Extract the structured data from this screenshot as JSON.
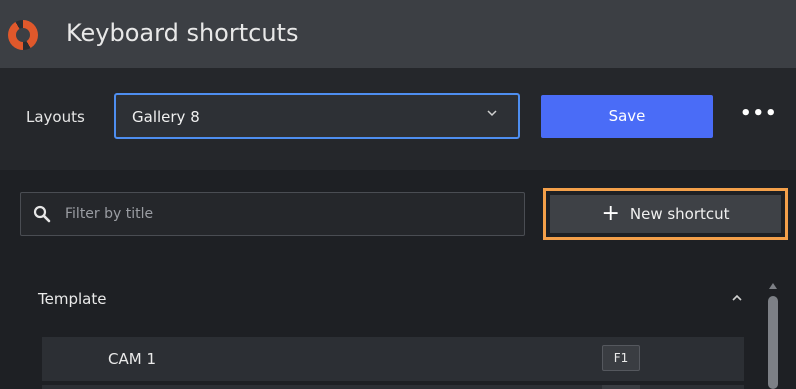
{
  "window": {
    "title": "Keyboard shortcuts"
  },
  "toolbar": {
    "layouts_label": "Layouts",
    "layout_selected": "Gallery 8",
    "save_label": "Save",
    "more_label": "•••"
  },
  "filter": {
    "placeholder": "Filter by title",
    "value": ""
  },
  "new_shortcut": {
    "label": "New shortcut",
    "icon": "plus-icon"
  },
  "groups": [
    {
      "title": "Template",
      "collapsed": false,
      "items": [
        {
          "label": "CAM 1",
          "key": "F1"
        }
      ]
    }
  ],
  "colors": {
    "accent": "#4a6cf7",
    "focus_border": "#4e8ef0",
    "highlight_outline": "#f4a04a",
    "logo": "#e0582b"
  }
}
